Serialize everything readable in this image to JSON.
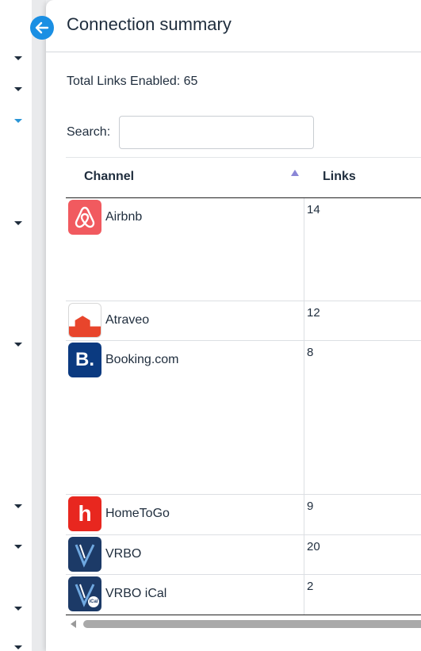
{
  "modal": {
    "title": "Connection summary",
    "total_links": "Total Links Enabled: 65",
    "search_label": "Search:",
    "search_value": ""
  },
  "table": {
    "headers": {
      "channel": "Channel",
      "links": "Links"
    },
    "sort": "channel-ascending",
    "rows": [
      {
        "channel": "Airbnb",
        "links": "14",
        "icon": "airbnb-logo"
      },
      {
        "channel": "Atraveo",
        "links": "12",
        "icon": "atraveo-logo"
      },
      {
        "channel": "Booking.com",
        "links": "8",
        "icon": "booking-logo"
      },
      {
        "channel": "HomeToGo",
        "links": "9",
        "icon": "hometogo-logo"
      },
      {
        "channel": "VRBO",
        "links": "20",
        "icon": "vrbo-logo"
      },
      {
        "channel": "VRBO iCal",
        "links": "2",
        "icon": "vrbo-ical-logo"
      }
    ]
  },
  "logos": {
    "booking_letter": "B.",
    "hometogo_letter": "h",
    "vrbo_ical_tag": "iCal"
  },
  "colors": {
    "accent": "#1a8fe3",
    "airbnb": "#f15a5f",
    "booking": "#0b3a80",
    "hometogo": "#e8271f",
    "vrbo": "#1c3a67"
  }
}
